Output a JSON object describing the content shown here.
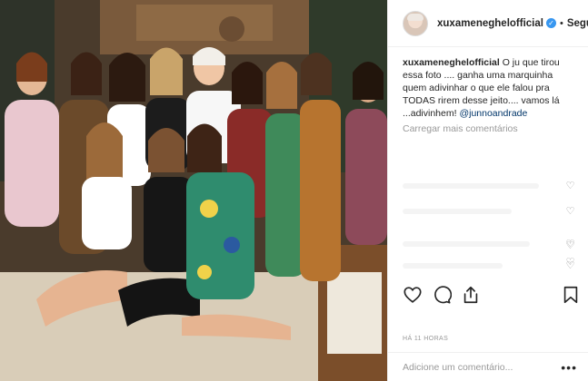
{
  "post": {
    "username": "xuxameneghelofficial",
    "verified": true,
    "separator": "•",
    "follow_status": "Seguindo",
    "caption_username": "xuxameneghelofficial",
    "caption_text": "O ju que tirou essa foto .... ganha uma marquinha quem adivinhar o que ele falou pra TODAS rirem desse jeito.... vamos lá ...adivinhem!",
    "mention": "@junnoandrade",
    "load_more_label": "Carregar mais comentários",
    "timestamp": "HÁ 11 HORAS",
    "add_comment_placeholder": "Adicione um comentário...",
    "more_label": "•••"
  },
  "icons": {
    "verified": "verified-badge-icon",
    "like": "heart-icon",
    "comment": "comment-bubble-icon",
    "share": "share-icon",
    "save": "bookmark-icon",
    "comment_like": "small-heart-icon"
  },
  "colors": {
    "text": "#262626",
    "muted": "#999999",
    "link": "#003569",
    "verified": "#3897f0",
    "border": "#efefef"
  }
}
